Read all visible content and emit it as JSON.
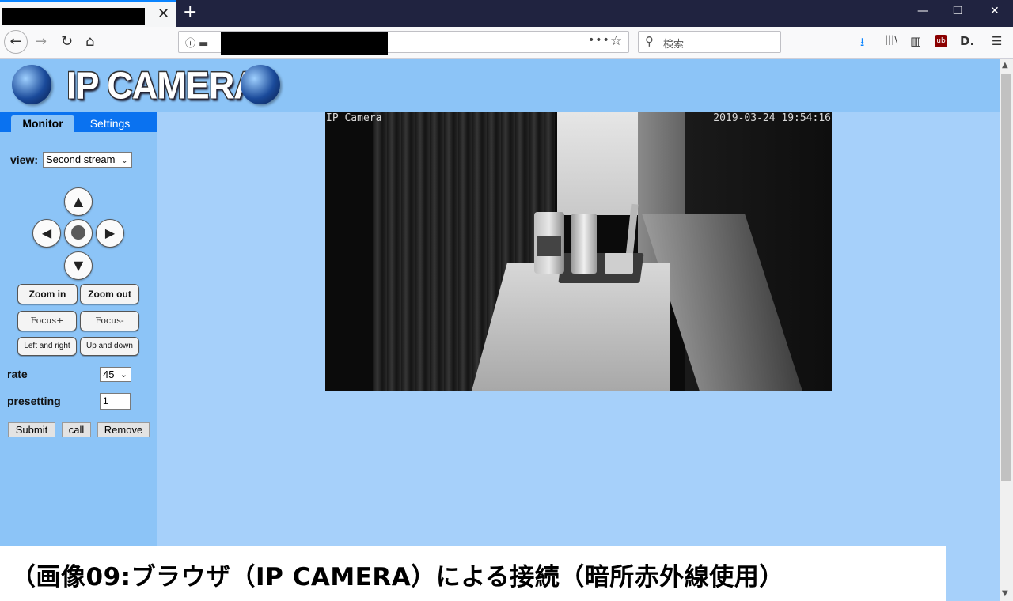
{
  "browser": {
    "tab_title": "",
    "tab_close": "✕",
    "new_tab": "+",
    "window_controls": {
      "minimize": "—",
      "restore": "❐",
      "close": "✕"
    },
    "nav": {
      "back": "←",
      "forward": "→",
      "reload": "↻",
      "home": "⌂"
    },
    "url": "",
    "url_more": "•••",
    "bookmark_star": "☆",
    "search_placeholder": "検索",
    "toolbar_icons": {
      "download": "⭳",
      "library": "|||\\",
      "sidebar": "▥",
      "ublock": "ub",
      "extension": "D.",
      "menu": "☰"
    }
  },
  "page": {
    "logo_text": "IP CAMERA",
    "tabs": {
      "monitor": "Monitor",
      "settings": "Settings"
    },
    "view_label": "view:",
    "view_value": "Second stream",
    "ptz": {
      "up": "▲",
      "left": "◀",
      "right": "▶",
      "down": "▼"
    },
    "buttons": {
      "zoom_in": "Zoom in",
      "zoom_out": "Zoom out",
      "focus_plus": "Focus+",
      "focus_minus": "Focus-",
      "left_right": "Left and right",
      "up_down": "Up and down",
      "submit": "Submit",
      "call": "call",
      "remove": "Remove"
    },
    "rate_label": "rate",
    "rate_value": "45",
    "presetting_label": "presetting",
    "presetting_value": "1"
  },
  "video": {
    "osd_name": "IP Camera",
    "osd_timestamp": "2019-03-24 19:54:16"
  },
  "caption": "（画像09:ブラウザ（IP CAMERA）による接続（暗所赤外線使用）",
  "colors": {
    "page_bg": "#a6d0fa",
    "panel_bg": "#8cc4f7",
    "tab_bar": "#0a72f0"
  }
}
